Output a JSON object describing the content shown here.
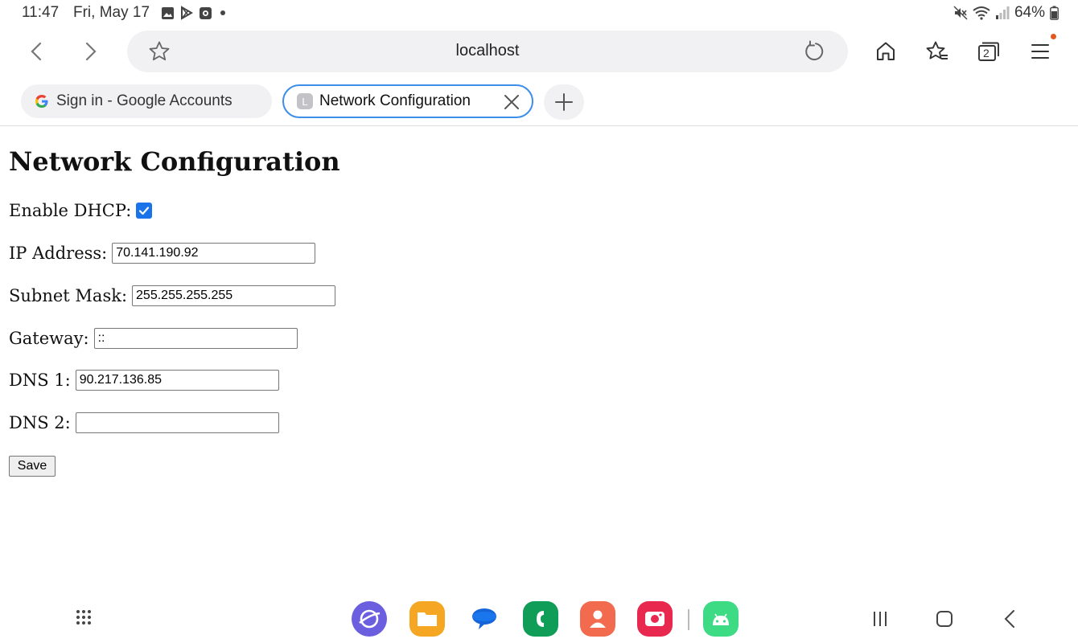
{
  "status_bar": {
    "time": "11:47",
    "date": "Fri, May 17",
    "battery": "64%",
    "notification_icons": [
      "gallery-icon",
      "play-store-icon",
      "screen-recorder-icon",
      "dot-icon"
    ],
    "system_icons": [
      "mute-icon",
      "wifi-icon",
      "signal-icon",
      "battery-icon"
    ]
  },
  "toolbar": {
    "url": "localhost",
    "tab_count": "2"
  },
  "tabs": [
    {
      "title": "Sign in - Google Accounts",
      "favicon": "G",
      "active": false
    },
    {
      "title": "Network Configuration",
      "favicon": "L",
      "active": true
    }
  ],
  "page": {
    "heading": "Network Configuration",
    "dhcp_label": "Enable DHCP:",
    "dhcp_checked": true,
    "fields": {
      "ip": {
        "label": "IP Address:",
        "value": "70.141.190.92"
      },
      "subnet": {
        "label": "Subnet Mask:",
        "value": "255.255.255.255"
      },
      "gateway": {
        "label": "Gateway:",
        "value": "::"
      },
      "dns1": {
        "label": "DNS 1:",
        "value": "90.217.136.85"
      },
      "dns2": {
        "label": "DNS 2:",
        "value": ""
      }
    },
    "save_label": "Save"
  },
  "colors": {
    "accent": "#1a73e8",
    "active_tab_border": "#3d8ee8"
  }
}
